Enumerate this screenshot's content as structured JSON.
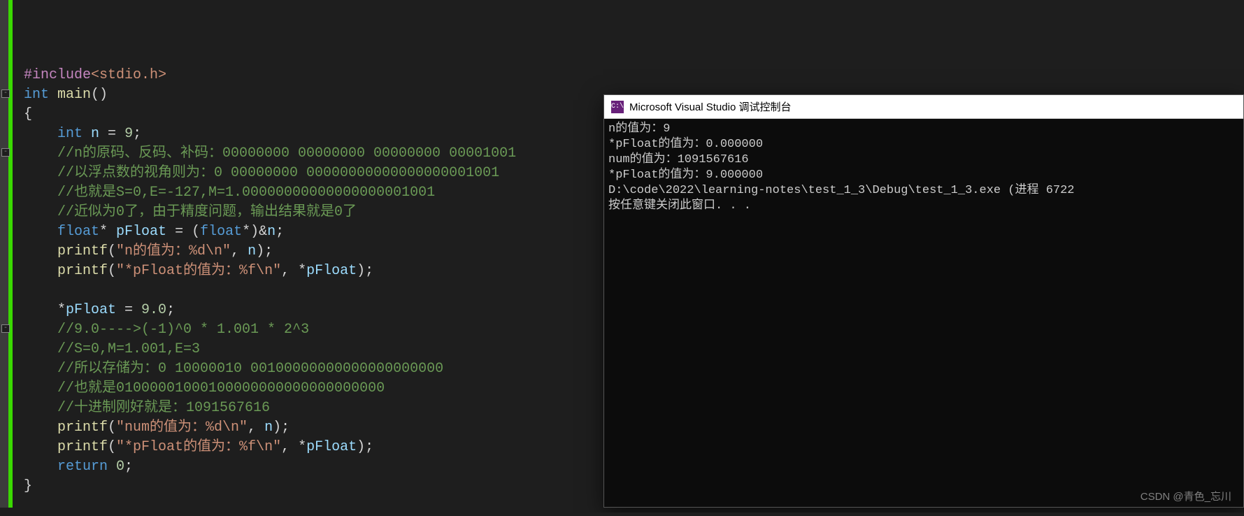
{
  "code": {
    "lines": [
      {
        "fold": null,
        "segments": [
          {
            "cls": "pp",
            "t": "#include"
          },
          {
            "cls": "inc",
            "t": "<stdio.h>"
          }
        ]
      },
      {
        "fold": "-",
        "segments": [
          {
            "cls": "kw",
            "t": "int "
          },
          {
            "cls": "fn",
            "t": "main"
          },
          {
            "cls": "punct",
            "t": "()"
          }
        ]
      },
      {
        "fold": null,
        "segments": [
          {
            "cls": "punct",
            "t": "{"
          }
        ]
      },
      {
        "fold": null,
        "segments": [
          {
            "cls": "punct",
            "t": "    "
          },
          {
            "cls": "kw",
            "t": "int "
          },
          {
            "cls": "ident",
            "t": "n"
          },
          {
            "cls": "op",
            "t": " = "
          },
          {
            "cls": "num",
            "t": "9"
          },
          {
            "cls": "punct",
            "t": ";"
          }
        ]
      },
      {
        "fold": "-",
        "segments": [
          {
            "cls": "com",
            "t": "    //n的原码、反码、补码：00000000 00000000 00000000 00001001"
          }
        ]
      },
      {
        "fold": null,
        "segments": [
          {
            "cls": "com",
            "t": "    //以浮点数的视角则为：0 00000000 00000000000000000001001"
          }
        ]
      },
      {
        "fold": null,
        "segments": [
          {
            "cls": "com",
            "t": "    //也就是S=0,E=-127,M=1.00000000000000000001001"
          }
        ]
      },
      {
        "fold": null,
        "segments": [
          {
            "cls": "com",
            "t": "    //近似为0了，由于精度问题，输出结果就是0了"
          }
        ]
      },
      {
        "fold": null,
        "segments": [
          {
            "cls": "punct",
            "t": "    "
          },
          {
            "cls": "kw",
            "t": "float"
          },
          {
            "cls": "op",
            "t": "* "
          },
          {
            "cls": "ident",
            "t": "pFloat"
          },
          {
            "cls": "op",
            "t": " = ("
          },
          {
            "cls": "kw",
            "t": "float"
          },
          {
            "cls": "op",
            "t": "*)&"
          },
          {
            "cls": "ident",
            "t": "n"
          },
          {
            "cls": "punct",
            "t": ";"
          }
        ]
      },
      {
        "fold": null,
        "segments": [
          {
            "cls": "punct",
            "t": "    "
          },
          {
            "cls": "fn",
            "t": "printf"
          },
          {
            "cls": "punct",
            "t": "("
          },
          {
            "cls": "str",
            "t": "\"n的值为：%d\\n\""
          },
          {
            "cls": "punct",
            "t": ", "
          },
          {
            "cls": "ident",
            "t": "n"
          },
          {
            "cls": "punct",
            "t": ");"
          }
        ]
      },
      {
        "fold": null,
        "segments": [
          {
            "cls": "punct",
            "t": "    "
          },
          {
            "cls": "fn",
            "t": "printf"
          },
          {
            "cls": "punct",
            "t": "("
          },
          {
            "cls": "str",
            "t": "\"*pFloat的值为：%f\\n\""
          },
          {
            "cls": "punct",
            "t": ", *"
          },
          {
            "cls": "ident",
            "t": "pFloat"
          },
          {
            "cls": "punct",
            "t": ");"
          }
        ]
      },
      {
        "fold": null,
        "segments": [
          {
            "cls": "punct",
            "t": ""
          }
        ]
      },
      {
        "fold": null,
        "segments": [
          {
            "cls": "punct",
            "t": "    *"
          },
          {
            "cls": "ident",
            "t": "pFloat"
          },
          {
            "cls": "op",
            "t": " = "
          },
          {
            "cls": "num",
            "t": "9.0"
          },
          {
            "cls": "punct",
            "t": ";"
          }
        ]
      },
      {
        "fold": "-",
        "segments": [
          {
            "cls": "com",
            "t": "    //9.0---->(-1)^0 * 1.001 * 2^3"
          }
        ]
      },
      {
        "fold": null,
        "segments": [
          {
            "cls": "com",
            "t": "    //S=0,M=1.001,E=3"
          }
        ]
      },
      {
        "fold": null,
        "segments": [
          {
            "cls": "com",
            "t": "    //所以存储为：0 10000010 00100000000000000000000"
          }
        ]
      },
      {
        "fold": null,
        "segments": [
          {
            "cls": "com",
            "t": "    //也就是01000001000100000000000000000000"
          }
        ]
      },
      {
        "fold": null,
        "segments": [
          {
            "cls": "com",
            "t": "    //十进制刚好就是：1091567616"
          }
        ]
      },
      {
        "fold": null,
        "segments": [
          {
            "cls": "punct",
            "t": "    "
          },
          {
            "cls": "fn",
            "t": "printf"
          },
          {
            "cls": "punct",
            "t": "("
          },
          {
            "cls": "str",
            "t": "\"num的值为：%d\\n\""
          },
          {
            "cls": "punct",
            "t": ", "
          },
          {
            "cls": "ident",
            "t": "n"
          },
          {
            "cls": "punct",
            "t": ");"
          }
        ]
      },
      {
        "fold": null,
        "segments": [
          {
            "cls": "punct",
            "t": "    "
          },
          {
            "cls": "fn",
            "t": "printf"
          },
          {
            "cls": "punct",
            "t": "("
          },
          {
            "cls": "str",
            "t": "\"*pFloat的值为：%f\\n\""
          },
          {
            "cls": "punct",
            "t": ", *"
          },
          {
            "cls": "ident",
            "t": "pFloat"
          },
          {
            "cls": "punct",
            "t": ");"
          }
        ]
      },
      {
        "fold": null,
        "segments": [
          {
            "cls": "punct",
            "t": "    "
          },
          {
            "cls": "kw",
            "t": "return "
          },
          {
            "cls": "num",
            "t": "0"
          },
          {
            "cls": "punct",
            "t": ";"
          }
        ]
      },
      {
        "fold": null,
        "segments": [
          {
            "cls": "punct",
            "t": "}"
          }
        ]
      }
    ]
  },
  "console": {
    "title": "Microsoft Visual Studio 调试控制台",
    "icon_text": "C:\\",
    "output": [
      "n的值为：9",
      "*pFloat的值为：0.000000",
      "num的值为：1091567616",
      "*pFloat的值为：9.000000",
      "",
      "D:\\code\\2022\\learning-notes\\test_1_3\\Debug\\test_1_3.exe (进程 6722",
      "按任意键关闭此窗口. . ."
    ]
  },
  "watermark": "CSDN @青色_忘川"
}
